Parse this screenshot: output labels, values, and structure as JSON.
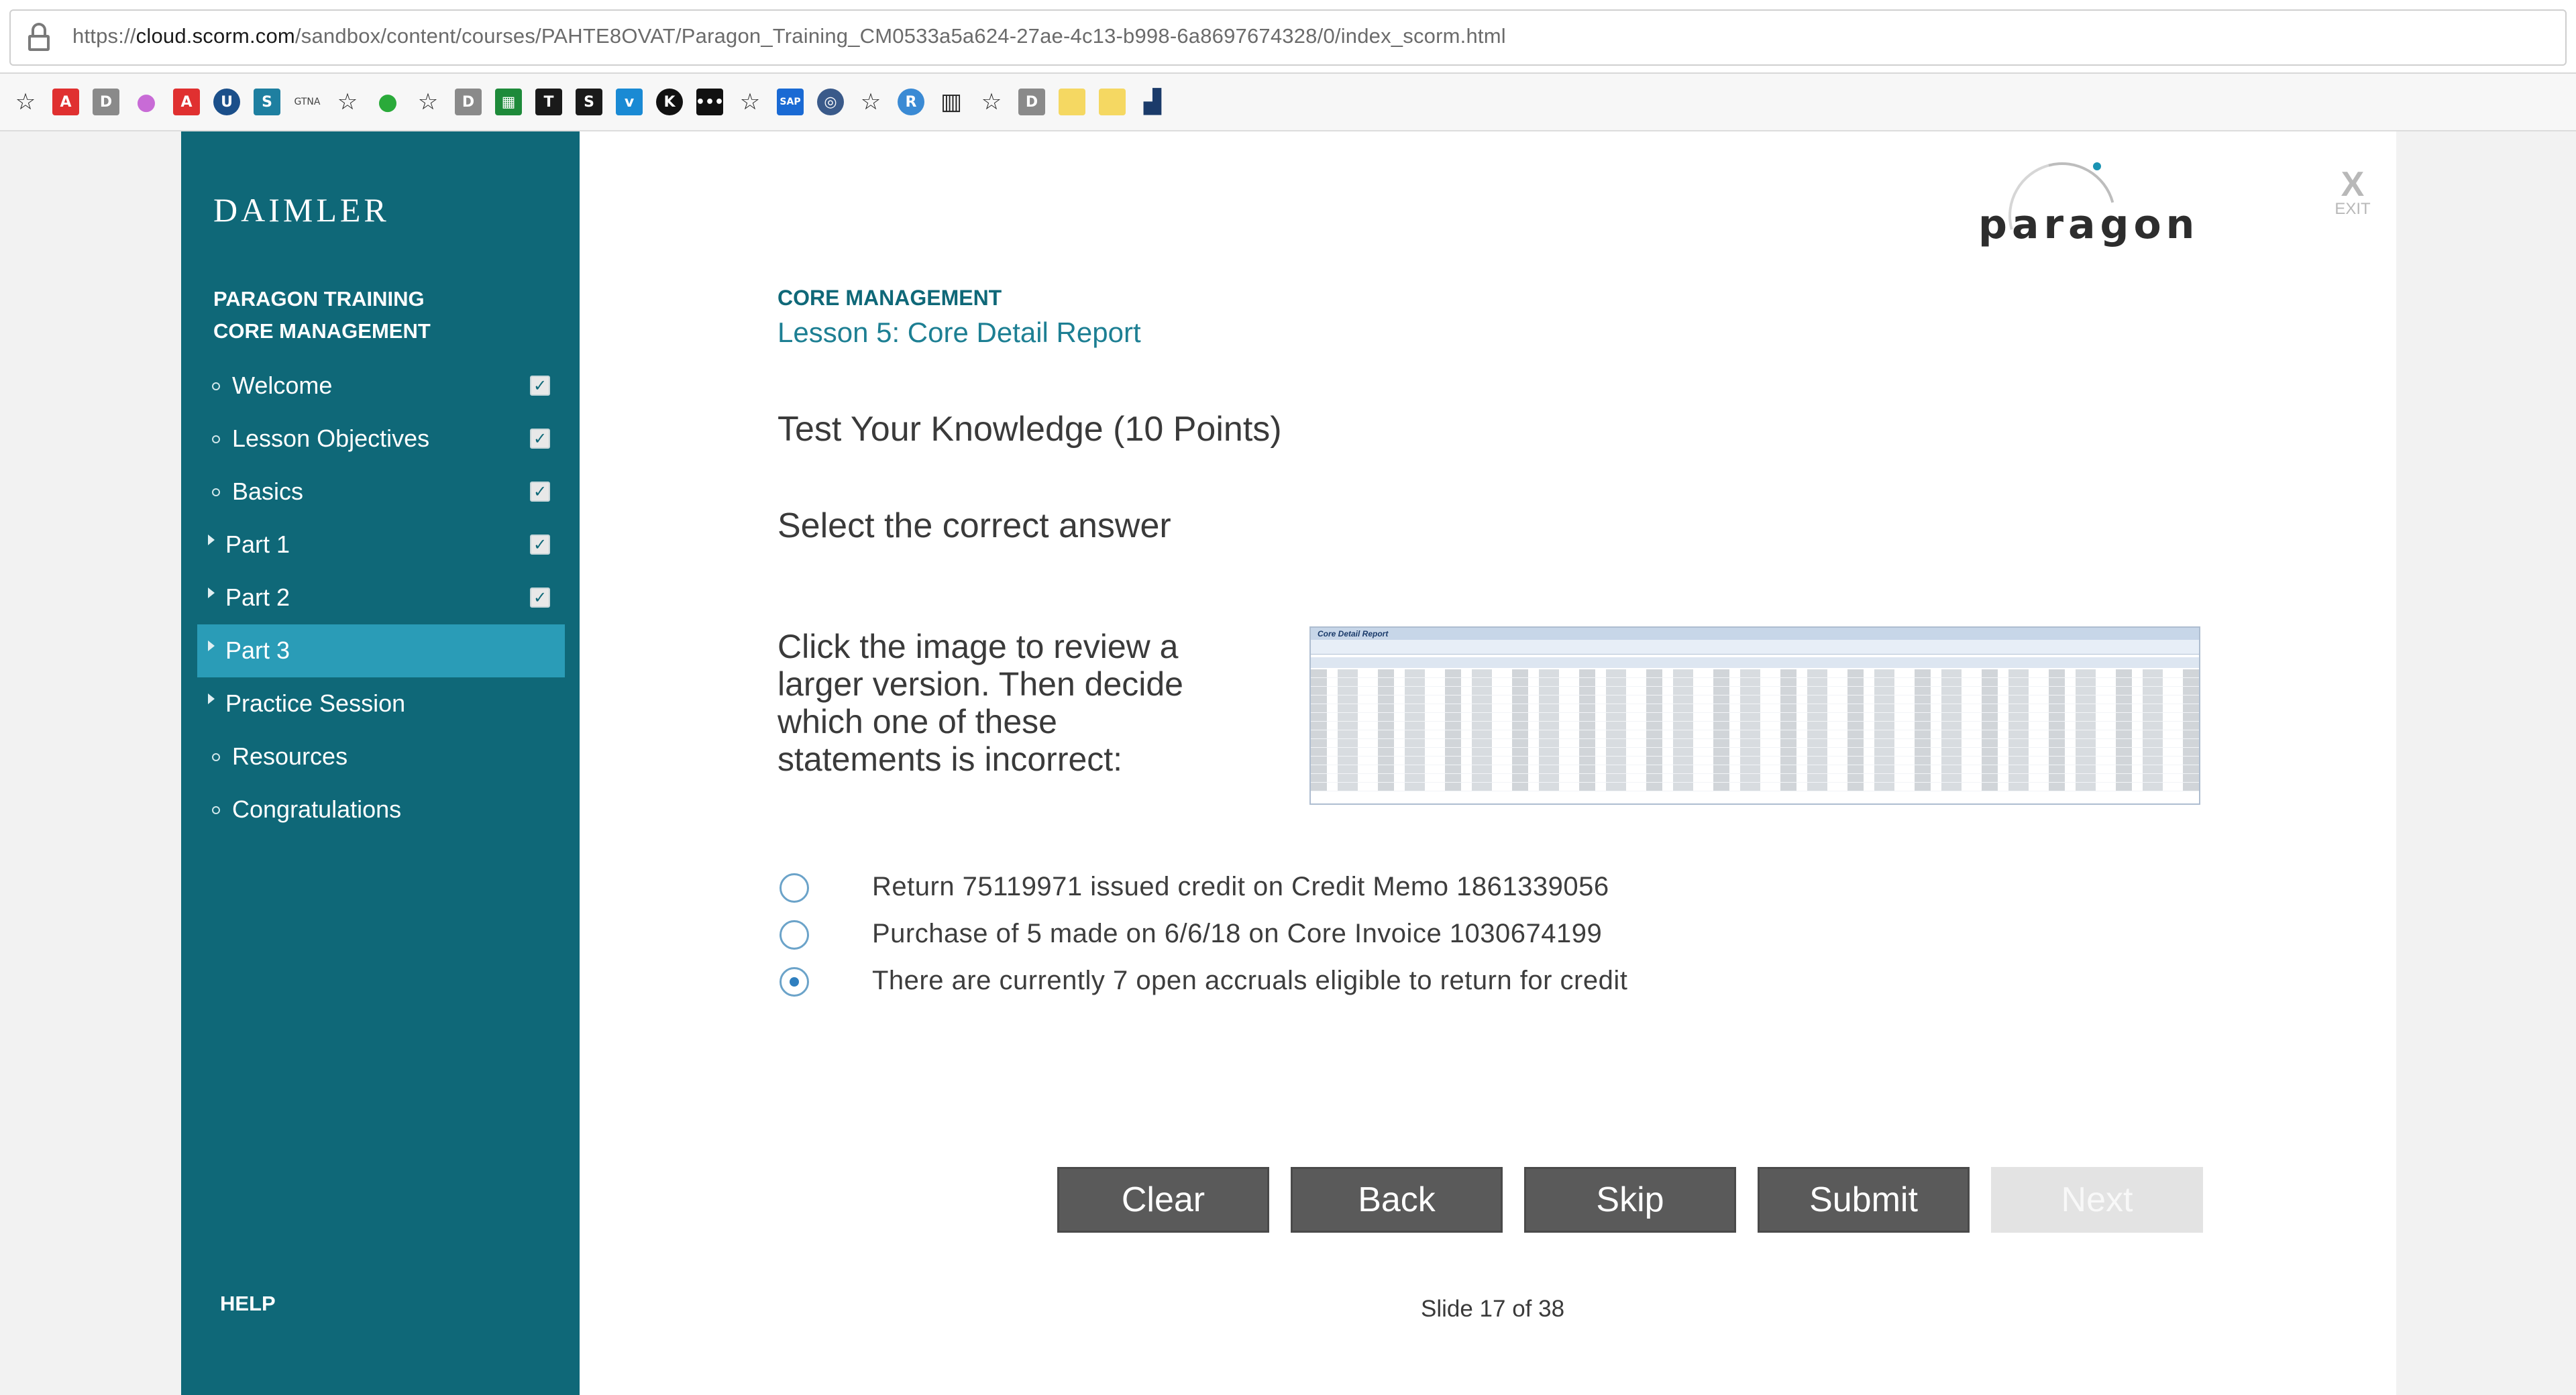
{
  "browser": {
    "url_prefix": "https://",
    "url_host": "cloud.scorm.com",
    "url_path": "/sandbox/content/courses/PAHTE8OVAT/Paragon_Training_CM0533a5a624-27ae-4c13-b998-6a8697674328/0/index_scorm.html"
  },
  "sidebar": {
    "logo": "DAIMLER",
    "course_line1": "PARAGON TRAINING",
    "course_line2": "CORE MANAGEMENT",
    "items": [
      {
        "label": "Welcome",
        "completed": true
      },
      {
        "label": "Lesson Objectives",
        "completed": true
      },
      {
        "label": "Basics",
        "completed": true
      },
      {
        "label": "Part 1",
        "completed": true
      },
      {
        "label": "Part 2",
        "completed": true
      },
      {
        "label": "Part 3",
        "completed": false,
        "active": true
      },
      {
        "label": "Practice Session",
        "completed": false
      },
      {
        "label": "Resources",
        "completed": false
      },
      {
        "label": "Congratulations",
        "completed": false
      }
    ],
    "help": "HELP"
  },
  "header": {
    "brand": "paragon",
    "exit_label": "EXIT"
  },
  "content": {
    "module": "CORE MANAGEMENT",
    "lesson": "Lesson 5: Core Detail Report",
    "question_title": "Test Your Knowledge (10 Points)",
    "instruction": "Select the correct answer",
    "prompt": "Click the image to review a larger version. Then decide which one of these statements is incorrect:",
    "thumbnail_title": "Core Detail Report",
    "options": [
      {
        "label": "Return 75119971 issued credit on Credit Memo 1861339056",
        "selected": false
      },
      {
        "label": "Purchase of 5 made on 6/6/18 on Core Invoice 1030674199",
        "selected": false
      },
      {
        "label": "There are currently 7 open accruals eligible to return for credit",
        "selected": true
      }
    ]
  },
  "buttons": {
    "clear": "Clear",
    "back": "Back",
    "skip": "Skip",
    "submit": "Submit",
    "next": "Next"
  },
  "footer": {
    "slide_counter": "Slide 17 of 38"
  },
  "colors": {
    "sidebar_bg": "#0f6878",
    "active_item": "#2a9cb7",
    "accent_text": "#0f6878",
    "button_bg": "#5a5a5a"
  }
}
